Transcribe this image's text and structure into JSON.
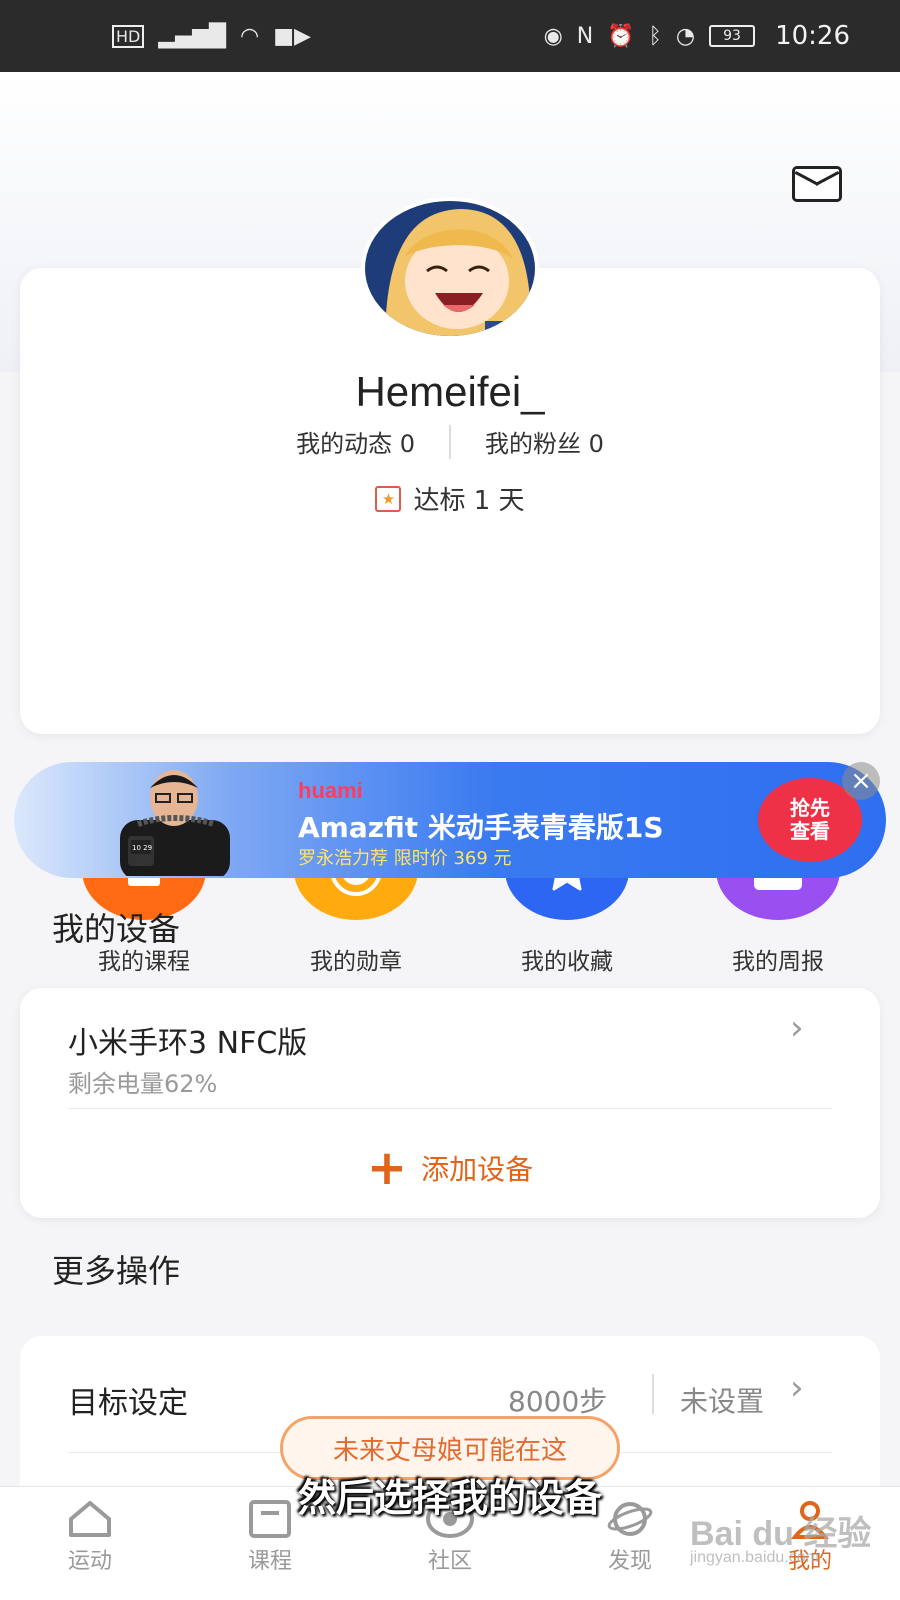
{
  "status_bar": {
    "left_icons": [
      "hd-icon",
      "signal-4g-icon",
      "wifi-icon",
      "video-icon"
    ],
    "right_icons": [
      "eye-icon",
      "nfc-icon",
      "alarm-icon",
      "bluetooth-icon",
      "speed-icon"
    ],
    "battery": "93",
    "time": "10:26"
  },
  "profile": {
    "username": "Hemeifei_",
    "posts_label": "我的动态 0",
    "fans_label": "我的粉丝 0",
    "goal_label": "达标 1 天"
  },
  "quick_actions": [
    {
      "label": "我的课程",
      "color": "#ff6a12",
      "icon": "course-icon",
      "badge": false
    },
    {
      "label": "我的勋章",
      "color": "#ffab0f",
      "icon": "medal-icon",
      "badge": true
    },
    {
      "label": "我的收藏",
      "color": "#2c66f2",
      "icon": "star-icon",
      "badge": false
    },
    {
      "label": "我的周报",
      "color": "#9a4ff0",
      "icon": "report-icon",
      "badge": true
    }
  ],
  "ad": {
    "brand": "huami",
    "title": "Amazfit 米动手表青春版1S",
    "subtitle": "罗永浩力荐  限时价 369 元",
    "cta": "抢先\n查看",
    "watch_time": "10 29"
  },
  "devices": {
    "section_title": "我的设备",
    "device_name": "小米手环3 NFC版",
    "device_battery": "剩余电量62%",
    "add_label": "添加设备"
  },
  "more": {
    "section_title": "更多操作",
    "goal_label": "目标设定",
    "steps": "8000步",
    "unset": "未设置"
  },
  "toast": "未来丈母娘可能在这",
  "caption": "然后选择我的设备",
  "tabs": [
    "运动",
    "课程",
    "社区",
    "发现",
    "我的"
  ],
  "watermark": {
    "main": "Bai du 经验",
    "sub": "jingyan.baidu.com"
  },
  "colors": {
    "accent": "#e0651a",
    "badge": "#f0525a"
  }
}
